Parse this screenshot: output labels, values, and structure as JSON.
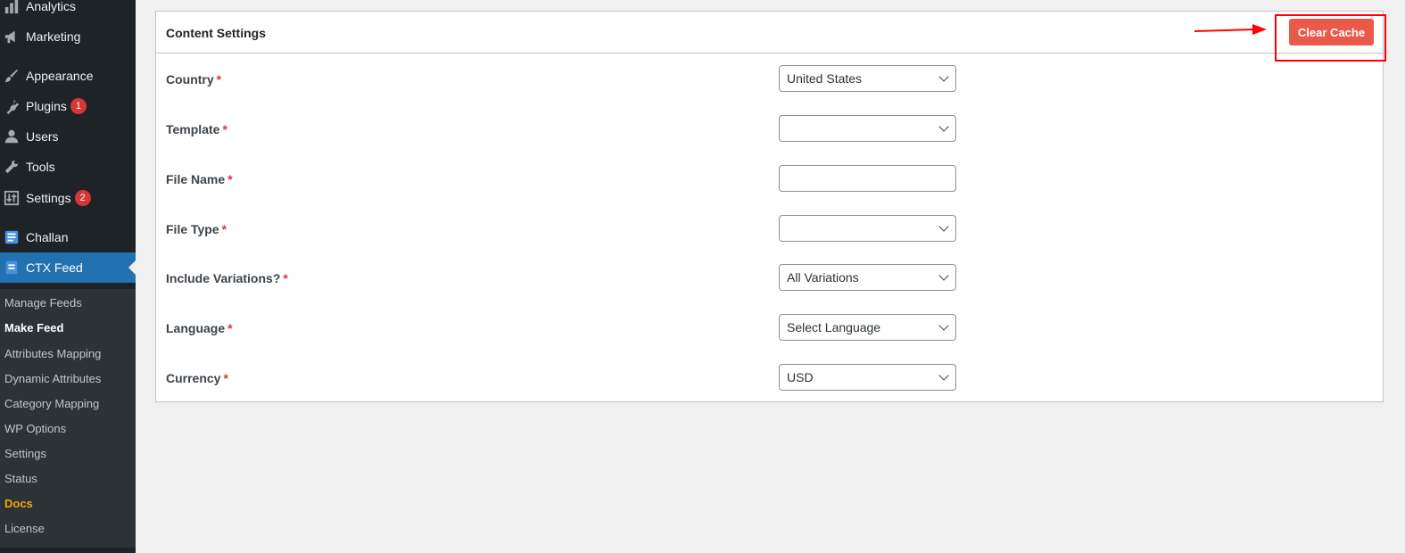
{
  "sidebar": {
    "menu": [
      {
        "label": "Analytics",
        "icon": "bar-chart-icon"
      },
      {
        "label": "Marketing",
        "icon": "megaphone-icon"
      },
      {
        "label": "Appearance",
        "icon": "paintbrush-icon"
      },
      {
        "label": "Plugins",
        "icon": "plug-icon",
        "badge": "1"
      },
      {
        "label": "Users",
        "icon": "user-icon"
      },
      {
        "label": "Tools",
        "icon": "wrench-icon"
      },
      {
        "label": "Settings",
        "icon": "sliders-icon",
        "badge": "2"
      },
      {
        "label": "Challan",
        "icon": "document-icon"
      },
      {
        "label": "CTX Feed",
        "icon": "feed-document-icon"
      }
    ],
    "submenu": [
      {
        "label": "Manage Feeds"
      },
      {
        "label": "Make Feed"
      },
      {
        "label": "Attributes Mapping"
      },
      {
        "label": "Dynamic Attributes"
      },
      {
        "label": "Category Mapping"
      },
      {
        "label": "WP Options"
      },
      {
        "label": "Settings"
      },
      {
        "label": "Status"
      },
      {
        "label": "Docs"
      },
      {
        "label": "License"
      }
    ]
  },
  "panel": {
    "title": "Content Settings",
    "clear_cache_label": "Clear Cache",
    "required_marker": "*",
    "fields": [
      {
        "label": "Country",
        "value": "United States"
      },
      {
        "label": "Template",
        "value": ""
      },
      {
        "label": "File Name",
        "value": ""
      },
      {
        "label": "File Type",
        "value": ""
      },
      {
        "label": "Include Variations?",
        "value": "All Variations"
      },
      {
        "label": "Language",
        "value": "Select Language"
      },
      {
        "label": "Currency",
        "value": "USD"
      }
    ]
  },
  "colors": {
    "accent": "#2271b1",
    "clear_cache": "#ea5a4a",
    "annotation": "#ff0000"
  }
}
